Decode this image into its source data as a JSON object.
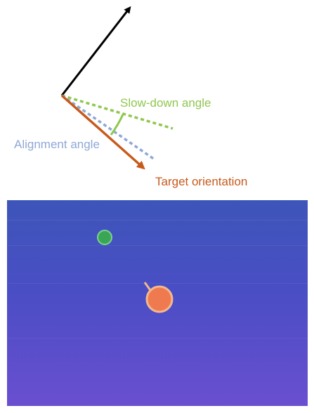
{
  "labels": {
    "slow_down_angle": "Slow-down angle",
    "alignment_angle": "Alignment angle",
    "target_orientation": "Target orientation"
  },
  "colors": {
    "slow_down": "#8fc74f",
    "alignment": "#90a8d6",
    "target": "#c75a1b",
    "heading": "#000000",
    "scene_top": "#3d55b9",
    "scene_bottom": "#6a4fd0",
    "target_dot": "#3aa655",
    "agent": "#f07a50",
    "agent_outline": "#f3b88e"
  }
}
